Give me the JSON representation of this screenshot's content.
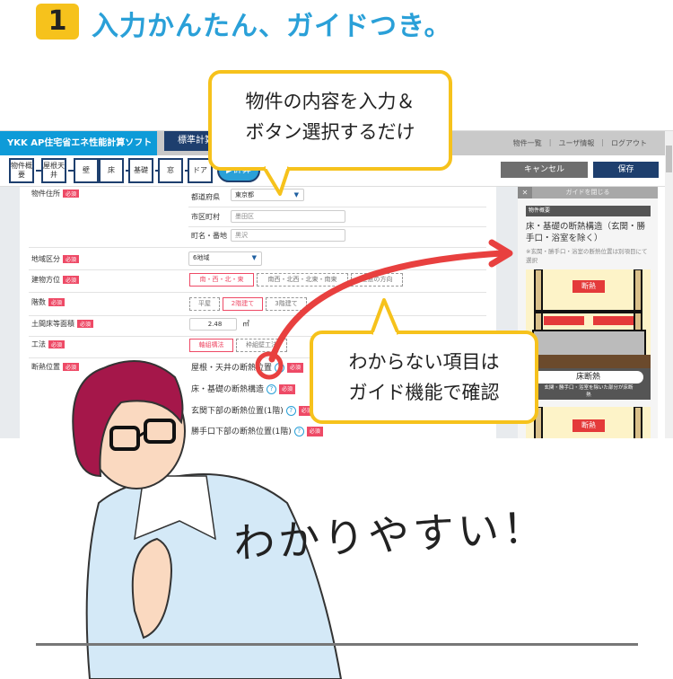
{
  "heading": {
    "number": "1",
    "title": "入力かんたん、ガイドつき。"
  },
  "app": {
    "title": "YKK AP住宅省エネ性能計算ソフト",
    "tab": "標準計算",
    "links": [
      "物件一覧",
      "ユーザ情報",
      "ログアウト"
    ],
    "steps": [
      "物件概要",
      "屋根天井",
      "壁",
      "床",
      "基礎",
      "窓",
      "ドア"
    ],
    "calc_label": "▶計算",
    "cancel_label": "キャンセル",
    "save_label": "保存",
    "required": "必須",
    "form": {
      "address_label": "物件住所",
      "pref_label": "都道府県",
      "pref_value": "東京都",
      "city_label": "市区町村",
      "city_value": "墨田区",
      "town_label": "町名・番地",
      "town_value": "黒沢",
      "region_label": "地域区分",
      "region_value": "6地域",
      "orient_label": "建物方位",
      "orient_options": [
        "南・西・北・東",
        "南西・北西・北東・南東",
        "任意の方向"
      ],
      "orient_selected": 0,
      "floors_label": "階数",
      "floors_options": [
        "平屋",
        "2階建て",
        "3階建て"
      ],
      "floors_selected": 1,
      "area_label": "土間床等面積",
      "area_value": "2.48",
      "area_unit": "㎡",
      "method_label": "工法",
      "method_options": [
        "軸組構法",
        "枠組壁工法"
      ],
      "method_selected": 0,
      "insul_label": "断熱位置",
      "insul_items": [
        "屋根・天井の断熱位置",
        "床・基礎の断熱構造",
        "玄関下部の断熱位置(1階)",
        "勝手口下部の断熱位置(1階)"
      ]
    },
    "guide": {
      "close_label": "ガイドを閉じる",
      "section": "物件概要",
      "heading": "床・基礎の断熱構造（玄関・勝手口・浴室を除く）",
      "note": "※玄関・勝手口・浴室の断熱位置は別項目にて選択",
      "tag": "断熱",
      "caption_title": "床断熱",
      "caption_text": "玄関・勝手口・浴室を除いた部分が床断熱"
    }
  },
  "bubble1": [
    "物件の内容を入力＆",
    "ボタン選択するだけ"
  ],
  "bubble2": [
    "わからない項目は",
    "ガイド機能で確認"
  ],
  "handwriting": "わかりやすい！",
  "colors": {
    "accent": "#2aa0d8",
    "navy": "#1e3f6e",
    "required": "#ee4a66",
    "bubble": "#f6c21c",
    "arrow": "#e8403f"
  }
}
